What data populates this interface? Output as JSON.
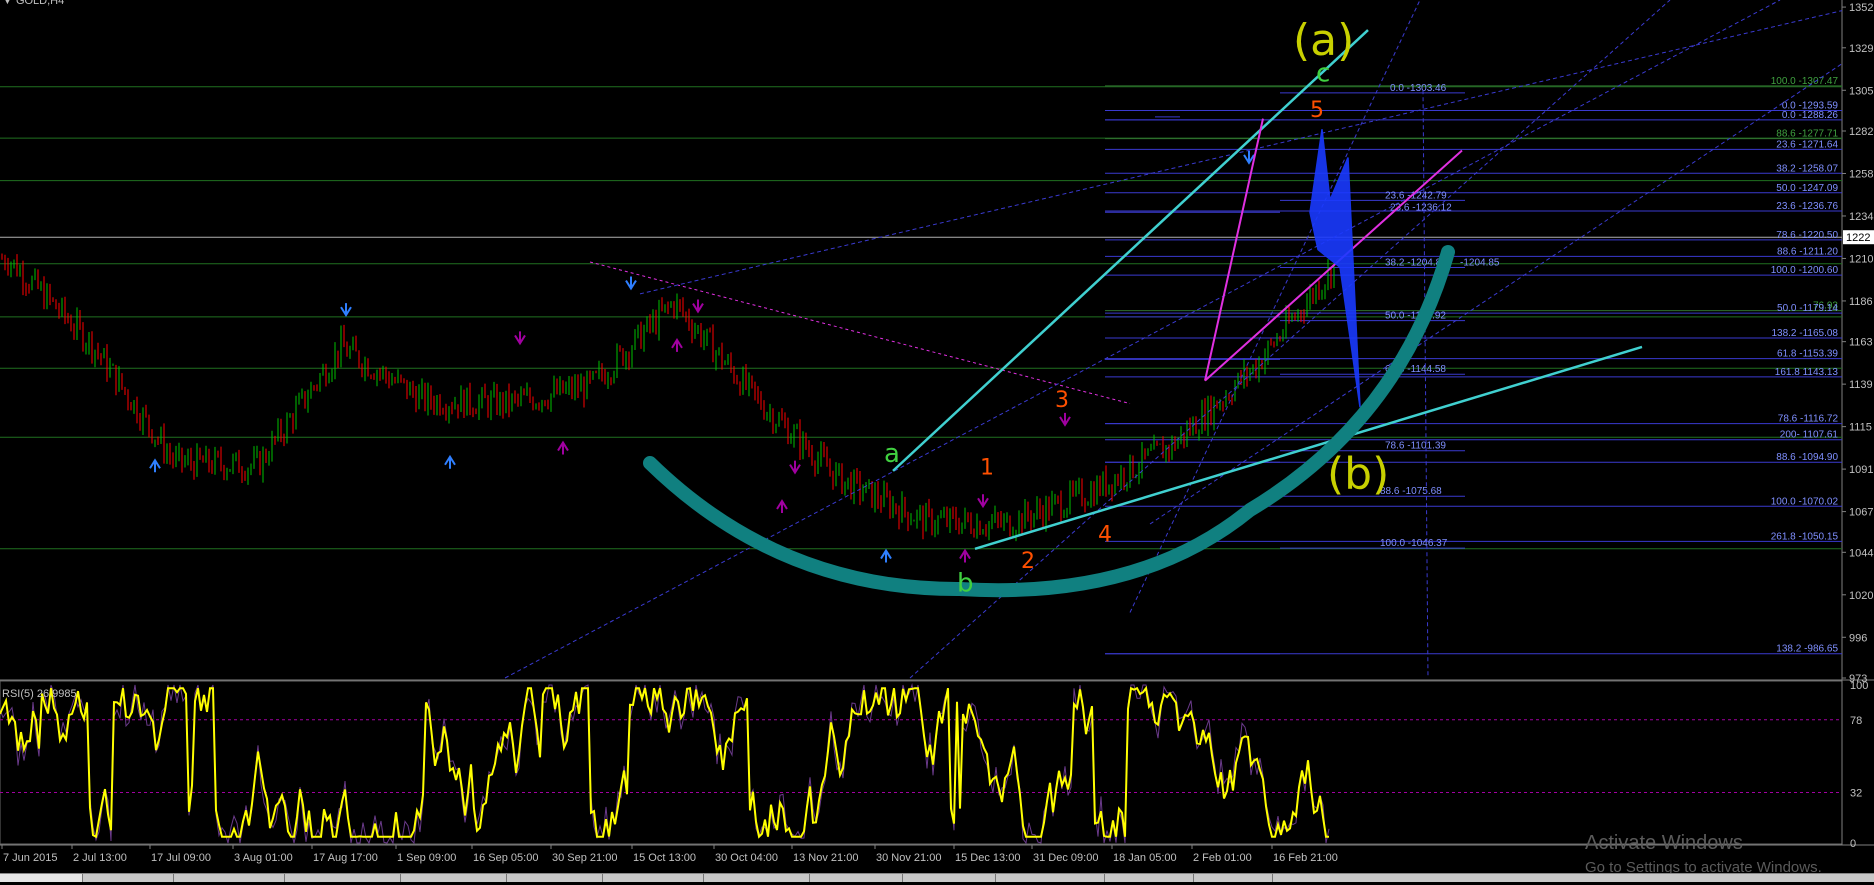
{
  "window": {
    "title": "GOLD,H4"
  },
  "price_axis": {
    "ticks": [
      "1352",
      "1329",
      "1305",
      "1282",
      "1258",
      "1234",
      "1210",
      "1186",
      "1163",
      "1139",
      "1115",
      "1091",
      "1067",
      "1044",
      "1020",
      "996",
      "973"
    ],
    "current": "1222",
    "range": [
      973,
      1356
    ]
  },
  "time_axis": {
    "labels": [
      "7 Jun 2015",
      "2 Jul 13:00",
      "17 Jul 09:00",
      "3 Aug 01:00",
      "17 Aug 17:00",
      "1 Sep 09:00",
      "16 Sep 05:00",
      "30 Sep 21:00",
      "15 Oct 13:00",
      "30 Oct 04:00",
      "13 Nov 21:00",
      "30 Nov 21:00",
      "15 Dec 13:00",
      "31 Dec 09:00",
      "18 Jan 05:00",
      "2 Feb 01:00",
      "16 Feb 21:00"
    ]
  },
  "fib_levels_right": [
    {
      "label": "100.0 -1307.47",
      "color": "#3fa03f"
    },
    {
      "label": "0.0 -1293.59",
      "color": "#7f8fff"
    },
    {
      "label": "0.0 -1288.26",
      "color": "#7f8fff"
    },
    {
      "label": "88.6 -1277.71",
      "color": "#3fa03f"
    },
    {
      "label": "23.6 -1271.64",
      "color": "#7f8fff"
    },
    {
      "label": "38.2 -1258.07",
      "color": "#7f8fff"
    },
    {
      "label": "50.0 -1247.09",
      "color": "#7f8fff"
    },
    {
      "label": "23.6 -1236.76",
      "color": "#7f8fff"
    },
    {
      "label": "78.6 -1220.50",
      "color": "#7f8fff"
    },
    {
      "label": "88.6 -1211.20",
      "color": "#7f8fff"
    },
    {
      "label": "100.0 -1200.60",
      "color": "#7f8fff"
    },
    {
      "label": "76.93",
      "color": "#3fa03f"
    },
    {
      "label": "50.0 -1179.14",
      "color": "#7f8fff"
    },
    {
      "label": "138.2 -1165.08",
      "color": "#7f8fff"
    },
    {
      "label": "61.8 -1153.39",
      "color": "#7f8fff"
    },
    {
      "label": "161.8 1143.13",
      "color": "#7f8fff"
    },
    {
      "label": "78.6 -1116.72",
      "color": "#7f8fff"
    },
    {
      "label": "200- 1107.61",
      "color": "#7f8fff"
    },
    {
      "label": "88.6 -1094.90",
      "color": "#7f8fff"
    },
    {
      "label": "100.0 -1070.02",
      "color": "#7f8fff"
    },
    {
      "label": "261.8 -1050.15",
      "color": "#7f8fff"
    },
    {
      "label": "138.2 -986.65",
      "color": "#7f8fff"
    }
  ],
  "fib_levels_mid": [
    {
      "label": "0.0 -1303.46"
    },
    {
      "label": "23.6 -1242.79"
    },
    {
      "label": "38.2 -1204.89"
    },
    {
      "label": "50.0 -1174.92"
    },
    {
      "label": "61.8 -1144.58"
    },
    {
      "label": "78.6 -1101.39"
    },
    {
      "label": "88.6 -1075.68"
    },
    {
      "label": "100.0 -1046.37"
    },
    {
      "label": "23.6 -1236.12"
    },
    {
      "label": "-1204.85"
    }
  ],
  "wave_labels": {
    "big_a": "(a)",
    "big_b": "(b)",
    "c": "c",
    "a": "a",
    "b": "b",
    "w1": "1",
    "w2": "2",
    "w3": "3",
    "w4": "4",
    "w5": "5"
  },
  "rsi": {
    "title": "RSI(5) 26.9985",
    "levels": [
      "100",
      "78",
      "32",
      "0"
    ]
  },
  "watermark": {
    "title": "Activate Windows",
    "subtitle": "Go to Settings to activate Windows."
  },
  "tabs": {
    "first": "GOLD,H4"
  },
  "colors": {
    "background": "#000000",
    "bull": "#00c000",
    "bear": "#ff0000",
    "grid_green": "#207020",
    "fib_blue": "#3a3ad0",
    "cyan": "#40d0d0",
    "magenta": "#e030e0",
    "teal": "#108080",
    "wave_green": "#40d040",
    "wave_orange": "#ff5000",
    "big_wave": "#c8d000",
    "rsi": "#ffff00",
    "axis_text": "#c0c0c0"
  },
  "chart_data": {
    "type": "candlestick",
    "title": "GOLD,H4",
    "ylim": [
      973,
      1356
    ],
    "x": [
      "7 Jun 2015",
      "2 Jul 13:00",
      "17 Jul 09:00",
      "3 Aug 01:00",
      "17 Aug 17:00",
      "1 Sep 09:00",
      "16 Sep 05:00",
      "30 Sep 21:00",
      "15 Oct 13:00",
      "30 Oct 04:00",
      "13 Nov 21:00",
      "30 Nov 21:00",
      "15 Dec 13:00",
      "31 Dec 09:00",
      "18 Jan 05:00",
      "2 Feb 01:00",
      "16 Feb 21:00"
    ],
    "series": [
      {
        "name": "GOLD,H4",
        "close": [
          1210,
          1162,
          1095,
          1093,
          1160,
          1130,
          1128,
          1138,
          1185,
          1130,
          1085,
          1062,
          1060,
          1078,
          1105,
          1150,
          1210
        ]
      },
      {
        "name": "RSI(5) 26.9985",
        "levels": [
          32,
          78
        ]
      }
    ]
  }
}
